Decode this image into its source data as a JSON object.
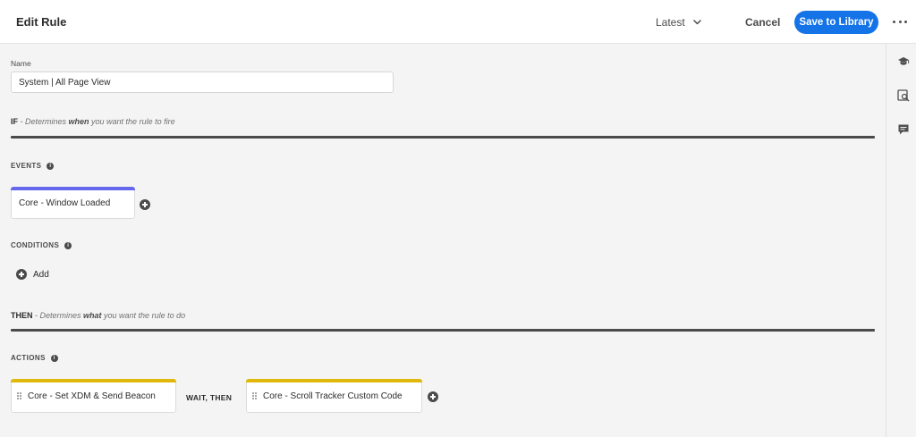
{
  "header": {
    "title": "Edit Rule",
    "version": "Latest",
    "cancel_label": "Cancel",
    "save_label": "Save to Library"
  },
  "name_field": {
    "label": "Name",
    "value": "System | All Page View"
  },
  "if_section": {
    "keyword": "IF",
    "dash": " - Determines ",
    "emphasis": "when",
    "rest": " you want the rule to fire"
  },
  "events": {
    "heading": "EVENTS",
    "items": [
      {
        "label": "Core - Window Loaded"
      }
    ]
  },
  "conditions": {
    "heading": "CONDITIONS",
    "add_label": "Add"
  },
  "then_section": {
    "keyword": "THEN",
    "dash": " - Determines ",
    "emphasis": "what",
    "rest": " you want the rule to do"
  },
  "actions": {
    "heading": "ACTIONS",
    "items": [
      {
        "label": "Core - Set XDM & Send Beacon"
      },
      {
        "label": "Core - Scroll Tracker Custom Code"
      }
    ],
    "separator": "WAIT, THEN"
  },
  "colors": {
    "accent_blue": "#1473e6",
    "event_bar": "#6767ec",
    "action_bar": "#e0b80b"
  },
  "icons": {
    "rail": [
      "graduation-cap-icon",
      "preview-search-icon",
      "comment-icon"
    ]
  }
}
